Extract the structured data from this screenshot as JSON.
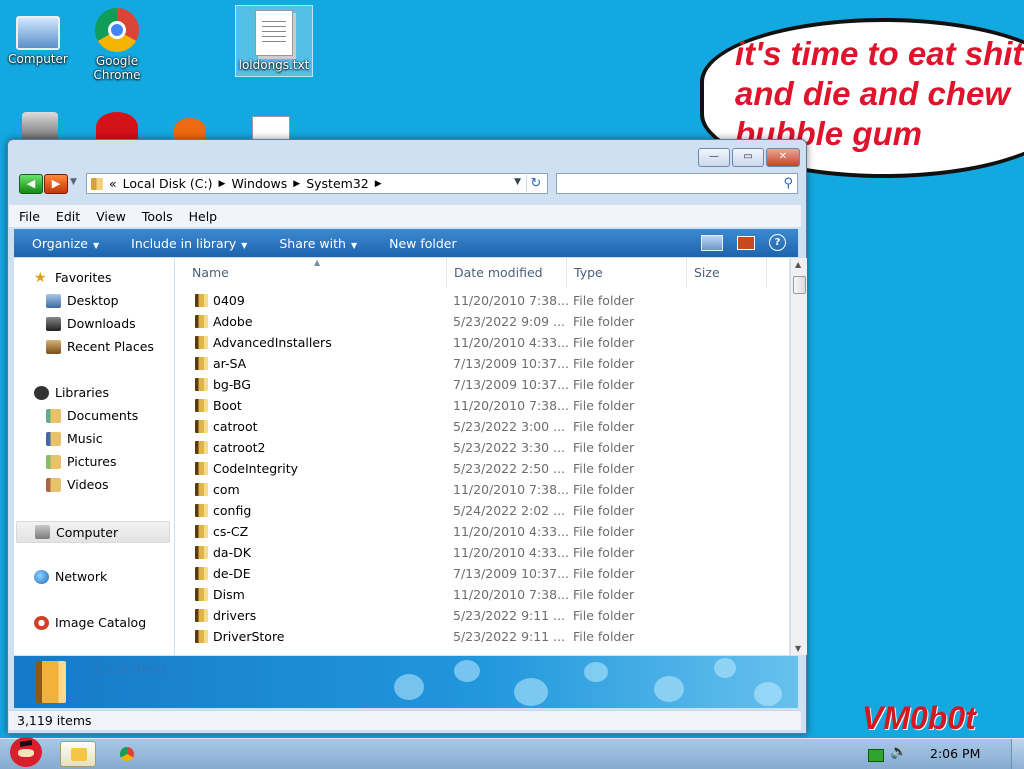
{
  "desktop": {
    "icons": [
      {
        "label": "Computer",
        "icon": "computer-icon"
      },
      {
        "label": "Google Chrome",
        "icon": "chrome-icon"
      },
      {
        "label": "loldongs.txt",
        "icon": "text-file-icon"
      }
    ],
    "bubble_text": "it's time to eat shit and die and chew bubble gum",
    "watermark": "VM0b0t"
  },
  "window": {
    "address": {
      "prefix": "«",
      "crumbs": [
        "Local Disk (C:)",
        "Windows",
        "System32"
      ],
      "search_placeholder": ""
    },
    "menu": [
      "File",
      "Edit",
      "View",
      "Tools",
      "Help"
    ],
    "toolbar": {
      "organize": "Organize",
      "include": "Include in library",
      "share": "Share with",
      "new_folder": "New folder",
      "help": "?"
    },
    "nav": {
      "favorites": "Favorites",
      "desktop": "Desktop",
      "downloads": "Downloads",
      "recent": "Recent Places",
      "libraries": "Libraries",
      "documents": "Documents",
      "music": "Music",
      "pictures": "Pictures",
      "videos": "Videos",
      "computer": "Computer",
      "network": "Network",
      "image_catalog": "Image Catalog"
    },
    "columns": {
      "name": "Name",
      "date": "Date modified",
      "type": "Type",
      "size": "Size"
    },
    "files": [
      {
        "name": "0409",
        "date": "11/20/2010 7:38...",
        "type": "File folder"
      },
      {
        "name": "Adobe",
        "date": "5/23/2022 9:09 ...",
        "type": "File folder"
      },
      {
        "name": "AdvancedInstallers",
        "date": "11/20/2010 4:33...",
        "type": "File folder"
      },
      {
        "name": "ar-SA",
        "date": "7/13/2009 10:37...",
        "type": "File folder"
      },
      {
        "name": "bg-BG",
        "date": "7/13/2009 10:37...",
        "type": "File folder"
      },
      {
        "name": "Boot",
        "date": "11/20/2010 7:38...",
        "type": "File folder"
      },
      {
        "name": "catroot",
        "date": "5/23/2022 3:00 ...",
        "type": "File folder"
      },
      {
        "name": "catroot2",
        "date": "5/23/2022 3:30 ...",
        "type": "File folder"
      },
      {
        "name": "CodeIntegrity",
        "date": "5/23/2022 2:50 ...",
        "type": "File folder"
      },
      {
        "name": "com",
        "date": "11/20/2010 7:38...",
        "type": "File folder"
      },
      {
        "name": "config",
        "date": "5/24/2022 2:02 ...",
        "type": "File folder"
      },
      {
        "name": "cs-CZ",
        "date": "11/20/2010 4:33...",
        "type": "File folder"
      },
      {
        "name": "da-DK",
        "date": "11/20/2010 4:33...",
        "type": "File folder"
      },
      {
        "name": "de-DE",
        "date": "7/13/2009 10:37...",
        "type": "File folder"
      },
      {
        "name": "Dism",
        "date": "11/20/2010 7:38...",
        "type": "File folder"
      },
      {
        "name": "drivers",
        "date": "5/23/2022 9:11 ...",
        "type": "File folder"
      },
      {
        "name": "DriverStore",
        "date": "5/23/2022 9:11 ...",
        "type": "File folder"
      }
    ],
    "details_count": "3,119 items",
    "status": "3,119 items"
  },
  "taskbar": {
    "clock": "2:06 PM",
    "pinned": [
      "explorer-icon",
      "chrome-icon"
    ]
  }
}
